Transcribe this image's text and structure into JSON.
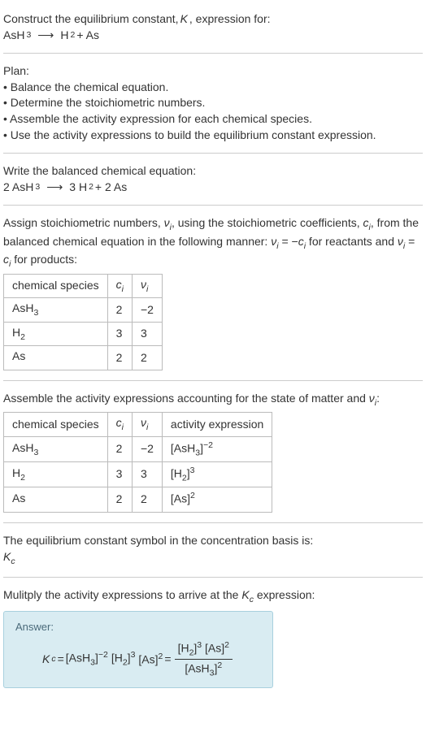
{
  "header": {
    "line1a": "Construct the equilibrium constant, ",
    "line1b": "K",
    "line1c": ", expression for:",
    "reaction_lhs": "AsH",
    "reaction_sub1": "3",
    "arrow": "⟶",
    "reaction_rhs1": "H",
    "reaction_sub2": "2",
    "reaction_plus": " + As"
  },
  "plan": {
    "title": "Plan:",
    "b1": "• Balance the chemical equation.",
    "b2": "• Determine the stoichiometric numbers.",
    "b3": "• Assemble the activity expression for each chemical species.",
    "b4": "• Use the activity expressions to build the equilibrium constant expression."
  },
  "balanced": {
    "title": "Write the balanced chemical equation:",
    "c1": "2 AsH",
    "s1": "3",
    "arrow": "⟶",
    "c2": "3 H",
    "s2": "2",
    "c3": " + 2 As"
  },
  "stoich": {
    "intro1": "Assign stoichiometric numbers, ",
    "nu": "ν",
    "i": "i",
    "intro2": ", using the stoichiometric coefficients, ",
    "c": "c",
    "intro3": ", from the balanced chemical equation in the following manner: ",
    "rel1a": "ν",
    "rel1b": " = −",
    "rel1c": "c",
    "rel1d": " for reactants and ",
    "rel2a": "ν",
    "rel2b": " = ",
    "rel2c": "c",
    "rel2d": " for products:"
  },
  "table1": {
    "h1": "chemical species",
    "h2a": "c",
    "h2b": "i",
    "h3a": "ν",
    "h3b": "i",
    "rows": [
      {
        "sp": "AsH",
        "sub": "3",
        "c": "2",
        "nu": "−2"
      },
      {
        "sp": "H",
        "sub": "2",
        "c": "3",
        "nu": "3"
      },
      {
        "sp": "As",
        "sub": "",
        "c": "2",
        "nu": "2"
      }
    ]
  },
  "activity": {
    "intro1": "Assemble the activity expressions accounting for the state of matter and ",
    "nu": "ν",
    "i": "i",
    "colon": ":"
  },
  "table2": {
    "h1": "chemical species",
    "h2a": "c",
    "h2b": "i",
    "h3a": "ν",
    "h3b": "i",
    "h4": "activity expression",
    "rows": [
      {
        "sp": "AsH",
        "sub": "3",
        "c": "2",
        "nu": "−2",
        "act_base": "[AsH",
        "act_sub": "3",
        "act_close": "]",
        "act_exp": "−2"
      },
      {
        "sp": "H",
        "sub": "2",
        "c": "3",
        "nu": "3",
        "act_base": "[H",
        "act_sub": "2",
        "act_close": "]",
        "act_exp": "3"
      },
      {
        "sp": "As",
        "sub": "",
        "c": "2",
        "nu": "2",
        "act_base": "[As",
        "act_sub": "",
        "act_close": "]",
        "act_exp": "2"
      }
    ]
  },
  "kc": {
    "line1": "The equilibrium constant symbol in the concentration basis is:",
    "sym": "K",
    "subc": "c"
  },
  "mult": {
    "line": "Mulitply the activity expressions to arrive at the ",
    "k": "K",
    "c": "c",
    "after": " expression:"
  },
  "answer": {
    "label": "Answer:",
    "kc_k": "K",
    "kc_c": "c",
    "eq": " = ",
    "t1": "[AsH",
    "t1s": "3",
    "t1c": "]",
    "t1e": "−2",
    "sp": " ",
    "t2": "[H",
    "t2s": "2",
    "t2c": "]",
    "t2e": "3",
    "t3": "[As]",
    "t3e": "2",
    "eq2": " = ",
    "num_a": "[H",
    "num_as": "2",
    "num_ac": "]",
    "num_ae": "3",
    "num_b": " [As]",
    "num_be": "2",
    "den_a": "[AsH",
    "den_as": "3",
    "den_ac": "]",
    "den_ae": "2"
  },
  "chart_data": {
    "type": "table",
    "title": "Stoichiometric numbers and activity expressions for AsH3 → H2 + As",
    "balanced_equation": "2 AsH3 ⟶ 3 H2 + 2 As",
    "columns": [
      "chemical species",
      "c_i",
      "ν_i",
      "activity expression"
    ],
    "rows": [
      [
        "AsH3",
        2,
        -2,
        "[AsH3]^(-2)"
      ],
      [
        "H2",
        3,
        3,
        "[H2]^3"
      ],
      [
        "As",
        2,
        2,
        "[As]^2"
      ]
    ],
    "equilibrium_constant": "K_c = [AsH3]^(-2) [H2]^3 [As]^2 = ([H2]^3 [As]^2) / [AsH3]^2"
  }
}
